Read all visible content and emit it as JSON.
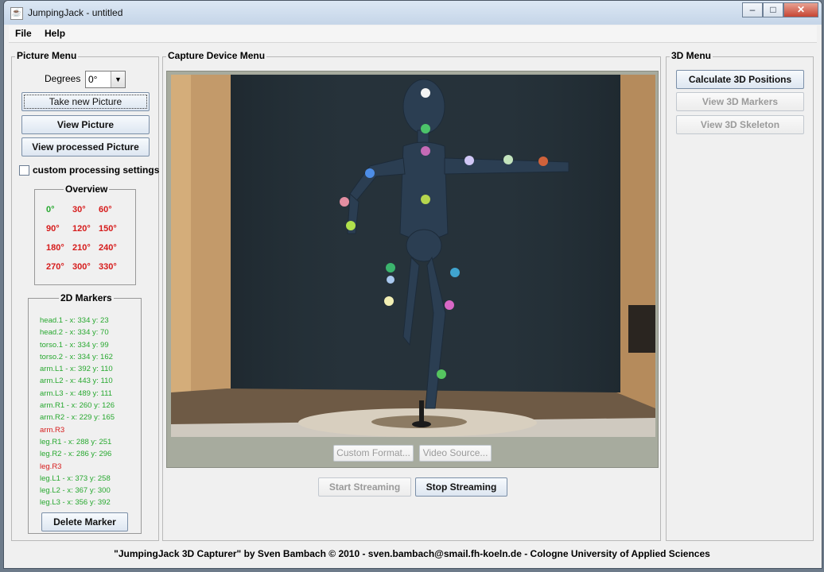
{
  "window": {
    "title": "JumpingJack - untitled",
    "icon": "java-cup-icon",
    "controls": [
      "minimize",
      "maximize",
      "close"
    ]
  },
  "menu": {
    "items": [
      "File",
      "Help"
    ]
  },
  "picture_menu": {
    "title": "Picture Menu",
    "degrees_label": "Degrees",
    "degrees_value": "0°",
    "take_picture": "Take new Picture",
    "view_picture": "View Picture",
    "view_processed": "View processed Picture",
    "custom_processing": "custom processing settings",
    "custom_processing_checked": false
  },
  "overview": {
    "title": "Overview",
    "angles": [
      {
        "label": "0°",
        "status": "done"
      },
      {
        "label": "30°",
        "status": "missing"
      },
      {
        "label": "60°",
        "status": "missing"
      },
      {
        "label": "90°",
        "status": "missing"
      },
      {
        "label": "120°",
        "status": "missing"
      },
      {
        "label": "150°",
        "status": "missing"
      },
      {
        "label": "180°",
        "status": "missing"
      },
      {
        "label": "210°",
        "status": "missing"
      },
      {
        "label": "240°",
        "status": "missing"
      },
      {
        "label": "270°",
        "status": "missing"
      },
      {
        "label": "300°",
        "status": "missing"
      },
      {
        "label": "330°",
        "status": "missing"
      }
    ],
    "colors": {
      "done": "#27a82f",
      "missing": "#d61b1b"
    }
  },
  "markers": {
    "title": "2D Markers",
    "items": [
      {
        "text": "head.1 - x: 334 y: 23",
        "ok": true
      },
      {
        "text": "head.2 - x: 334 y: 70",
        "ok": true
      },
      {
        "text": "torso.1 - x: 334 y: 99",
        "ok": true
      },
      {
        "text": "torso.2 - x: 334 y: 162",
        "ok": true
      },
      {
        "text": "arm.L1 - x: 392 y: 110",
        "ok": true
      },
      {
        "text": "arm.L2 - x: 443 y: 110",
        "ok": true
      },
      {
        "text": "arm.L3 - x: 489 y: 111",
        "ok": true
      },
      {
        "text": "arm.R1 - x: 260 y: 126",
        "ok": true
      },
      {
        "text": "arm.R2 - x: 229 y: 165",
        "ok": true
      },
      {
        "text": "arm.R3",
        "ok": false
      },
      {
        "text": "leg.R1 - x: 288 y: 251",
        "ok": true
      },
      {
        "text": "leg.R2 - x: 286 y: 296",
        "ok": true
      },
      {
        "text": "leg.R3",
        "ok": false
      },
      {
        "text": "leg.L1 - x: 373 y: 258",
        "ok": true
      },
      {
        "text": "leg.L2 - x: 367 y: 300",
        "ok": true
      },
      {
        "text": "leg.L3 - x: 356 y: 392",
        "ok": true
      }
    ],
    "delete_label": "Delete Marker"
  },
  "capture": {
    "title": "Capture Device Menu",
    "custom_format": "Custom Format...",
    "video_source": "Video Source...",
    "start_streaming": "Start Streaming",
    "stop_streaming": "Stop Streaming"
  },
  "three_d": {
    "title": "3D Menu",
    "calculate": "Calculate 3D Positions",
    "view_markers": "View 3D Markers",
    "view_skeleton": "View 3D Skeleton"
  },
  "status": "\"JumpingJack 3D Capturer\" by Sven Bambach © 2010  -  sven.bambach@smail.fh-koeln.de - Cologne University of Applied Sciences"
}
